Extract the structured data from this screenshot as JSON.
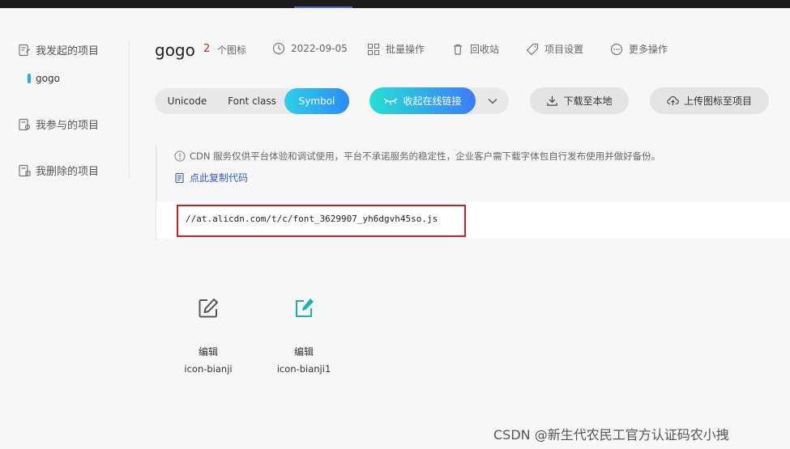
{
  "sidebar": {
    "my_projects": "我发起的项目",
    "active_project": "gogo",
    "joined_projects": "我参与的项目",
    "deleted_projects": "我删除的项目"
  },
  "header": {
    "project_name": "gogo",
    "icon_count": "2",
    "icon_count_label": "个图标",
    "date": "2022-09-05",
    "batch_ops": "批量操作",
    "recycle_bin": "回收站",
    "project_settings": "项目设置",
    "more_ops": "更多操作"
  },
  "tabs": {
    "unicode": "Unicode",
    "font_class": "Font class",
    "symbol": "Symbol",
    "selected": "Symbol"
  },
  "actions": {
    "cdn_link": "收起在线链接",
    "download": "下载至本地",
    "upload": "上传图标至项目"
  },
  "notice": {
    "text": "CDN 服务仅供平台体验和调试使用，平台不承诺服务的稳定性，企业客户需下载字体包自行发布使用并做好备份。",
    "copy_code": "点此复制代码",
    "cdn_url": "//at.alicdn.com/t/c/font_3629907_yh6dgvh45so.js"
  },
  "icons": [
    {
      "label": "编辑",
      "code": "icon-bianji",
      "color": "#555555"
    },
    {
      "label": "编辑",
      "code": "icon-bianji1",
      "color": "#1ab5a8"
    }
  ],
  "watermark": "CSDN @新生代农民工官方认证码农小拽",
  "colors": {
    "accent": "#2b8cf5",
    "highlight_frame": "#d21f1f",
    "count": "#e02020"
  }
}
